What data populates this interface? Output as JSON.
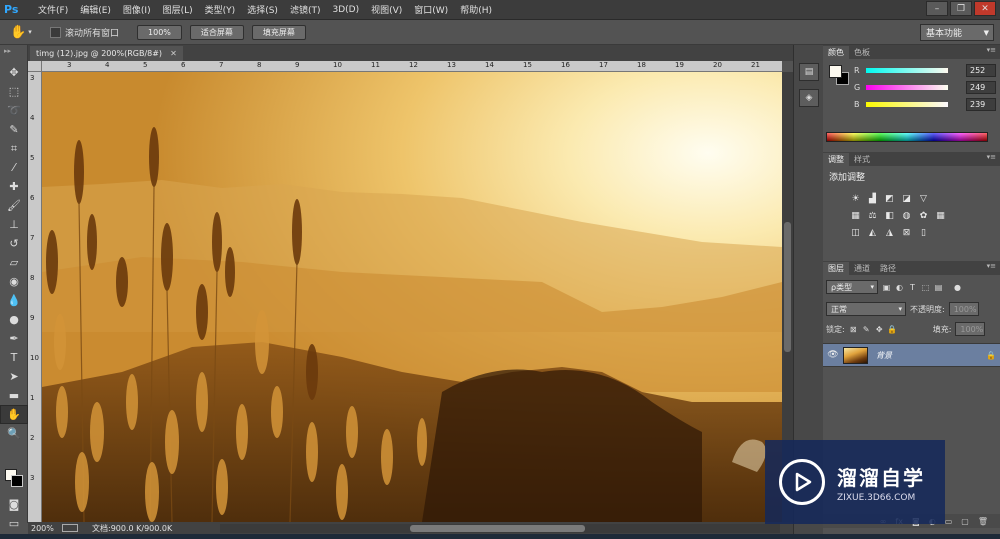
{
  "app": {
    "logo": "Ps"
  },
  "menu": [
    "文件(F)",
    "编辑(E)",
    "图像(I)",
    "图层(L)",
    "类型(Y)",
    "选择(S)",
    "滤镜(T)",
    "3D(D)",
    "视图(V)",
    "窗口(W)",
    "帮助(H)"
  ],
  "window_controls": {
    "minimize": "–",
    "restore": "❐",
    "close": "✕"
  },
  "options": {
    "scroll_all": "滚动所有窗口",
    "zoom_100": "100%",
    "fit_screen": "适合屏幕",
    "fill_screen": "填充屏幕",
    "workspace": "基本功能"
  },
  "document": {
    "tab_title": "timg (12).jpg @ 200%(RGB/8#)",
    "zoom": "200%",
    "doc_info": "文档:900.0 K/900.0K"
  },
  "ruler": {
    "h_ticks": [
      "3",
      "4",
      "5",
      "6",
      "7",
      "8",
      "9",
      "10",
      "11",
      "12",
      "13",
      "14",
      "15",
      "16",
      "17",
      "18",
      "19",
      "20",
      "21"
    ],
    "v_ticks": [
      "3",
      "4",
      "5",
      "6",
      "7",
      "8",
      "9",
      "10",
      "1",
      "2",
      "3"
    ]
  },
  "color_panel": {
    "tabs": [
      "颜色",
      "色板"
    ],
    "r": {
      "label": "R",
      "value": "252"
    },
    "g": {
      "label": "G",
      "value": "249"
    },
    "b": {
      "label": "B",
      "value": "239"
    },
    "fg_color": "#fcf9ef",
    "bg_color": "#000000"
  },
  "adjust_panel": {
    "tabs": [
      "调整",
      "样式"
    ],
    "title": "添加调整"
  },
  "layers_panel": {
    "tabs": [
      "图层",
      "通道",
      "路径"
    ],
    "filter_kind": "ρ类型",
    "blend_mode": "正常",
    "opacity_label": "不透明度:",
    "opacity_value": "100%",
    "lock_label": "锁定:",
    "fill_label": "填充:",
    "fill_value": "100%",
    "layers": [
      {
        "name": "背景",
        "visible": true,
        "locked": true
      }
    ]
  },
  "watermark": {
    "name": "溜溜自学",
    "url": "ZIXUE.3D66.COM"
  }
}
